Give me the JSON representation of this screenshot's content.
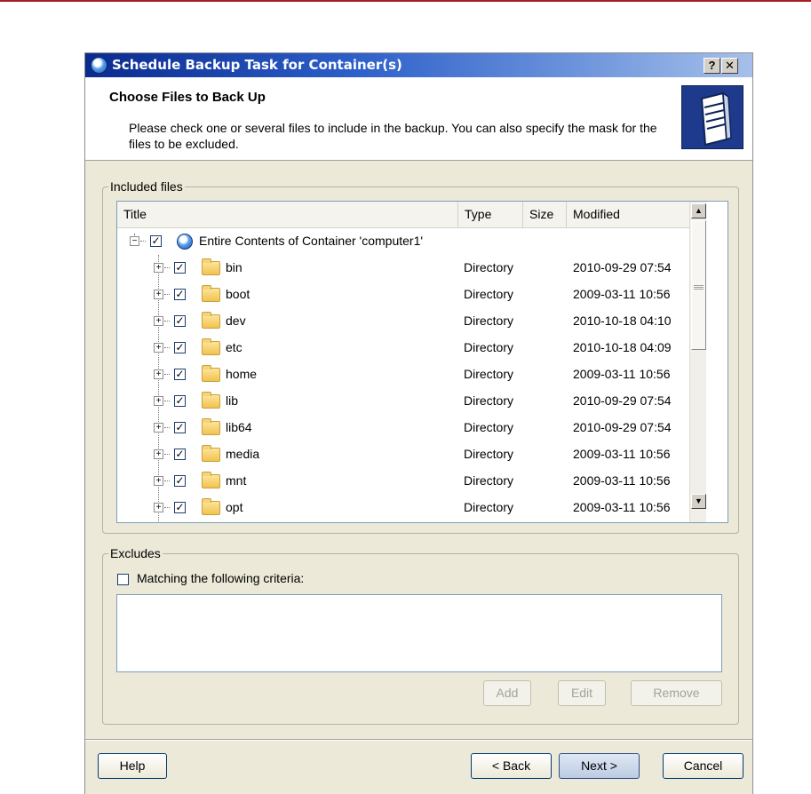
{
  "window": {
    "title": "Schedule Backup Task for Container(s)",
    "help_glyph": "?",
    "close_glyph": "✕"
  },
  "header": {
    "title": "Choose Files to Back Up",
    "description": "Please check one or several files to include in the backup. You can also specify the mask for the files to be excluded.",
    "icon": "server-icon"
  },
  "included": {
    "legend": "Included files",
    "columns": {
      "title": "Title",
      "type": "Type",
      "size": "Size",
      "modified": "Modified"
    },
    "root": {
      "label": "Entire Contents of Container 'computer1'",
      "checked": true,
      "expanded": true
    },
    "rows": [
      {
        "name": "bin",
        "type": "Directory",
        "size": "",
        "modified": "2010-09-29 07:54",
        "checked": true
      },
      {
        "name": "boot",
        "type": "Directory",
        "size": "",
        "modified": "2009-03-11 10:56",
        "checked": true
      },
      {
        "name": "dev",
        "type": "Directory",
        "size": "",
        "modified": "2010-10-18 04:10",
        "checked": true
      },
      {
        "name": "etc",
        "type": "Directory",
        "size": "",
        "modified": "2010-10-18 04:09",
        "checked": true
      },
      {
        "name": "home",
        "type": "Directory",
        "size": "",
        "modified": "2009-03-11 10:56",
        "checked": true
      },
      {
        "name": "lib",
        "type": "Directory",
        "size": "",
        "modified": "2010-09-29 07:54",
        "checked": true
      },
      {
        "name": "lib64",
        "type": "Directory",
        "size": "",
        "modified": "2010-09-29 07:54",
        "checked": true
      },
      {
        "name": "media",
        "type": "Directory",
        "size": "",
        "modified": "2009-03-11 10:56",
        "checked": true
      },
      {
        "name": "mnt",
        "type": "Directory",
        "size": "",
        "modified": "2009-03-11 10:56",
        "checked": true
      },
      {
        "name": "opt",
        "type": "Directory",
        "size": "",
        "modified": "2009-03-11 10:56",
        "checked": true
      }
    ]
  },
  "excludes": {
    "legend": "Excludes",
    "criteria_label": "Matching the following criteria:",
    "criteria_checked": false,
    "add_label": "Add",
    "edit_label": "Edit",
    "remove_label": "Remove"
  },
  "footer": {
    "help_label": "Help",
    "back_label": "< Back",
    "next_label": "Next >",
    "cancel_label": "Cancel"
  },
  "colors": {
    "accent_rule": "#a81c24",
    "titlebar_start": "#0b2a8e",
    "dialog_face": "#ece9d8"
  }
}
